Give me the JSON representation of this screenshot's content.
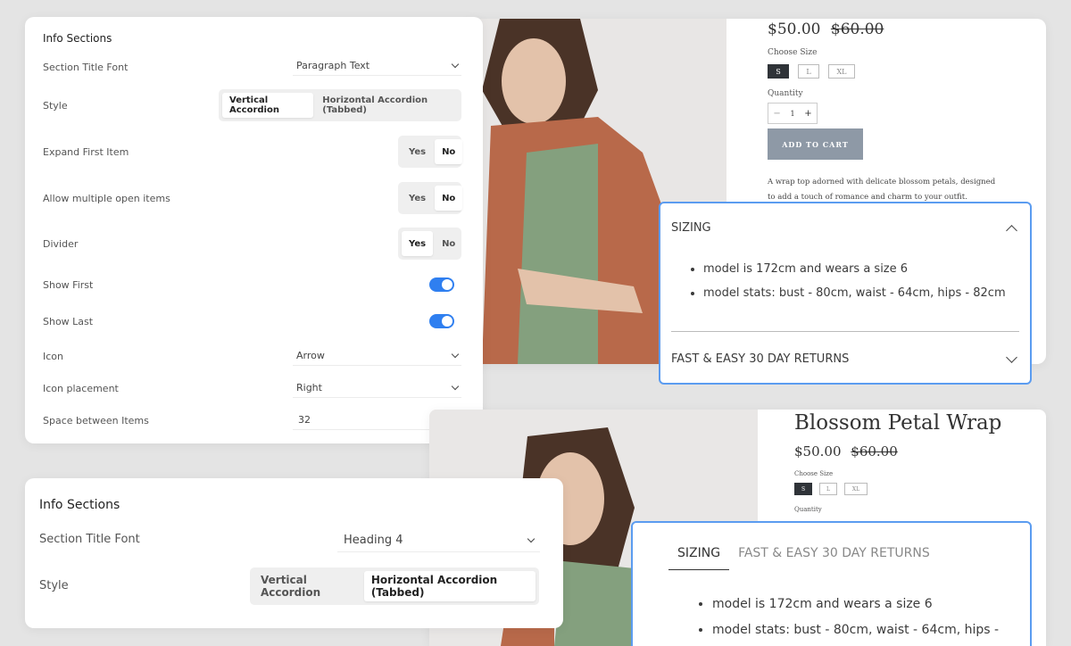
{
  "settings_full": {
    "heading": "Info Sections",
    "section_title_font": {
      "label": "Section Title Font",
      "value": "Paragraph Text"
    },
    "style": {
      "label": "Style",
      "options": [
        "Vertical Accordion",
        "Horizontal Accordion (Tabbed)"
      ],
      "selected": "Vertical Accordion"
    },
    "expand_first": {
      "label": "Expand First Item",
      "yes": "Yes",
      "no": "No",
      "selected": "No"
    },
    "allow_multiple": {
      "label": "Allow multiple open items",
      "yes": "Yes",
      "no": "No",
      "selected": "No"
    },
    "divider": {
      "label": "Divider",
      "yes": "Yes",
      "no": "No",
      "selected": "Yes"
    },
    "show_first": {
      "label": "Show First",
      "on": true
    },
    "show_last": {
      "label": "Show Last",
      "on": true
    },
    "icon": {
      "label": "Icon",
      "value": "Arrow"
    },
    "icon_placement": {
      "label": "Icon placement",
      "value": "Right"
    },
    "space_between": {
      "label": "Space between Items",
      "value": "32"
    }
  },
  "settings_small": {
    "heading": "Info Sections",
    "section_title_font": {
      "label": "Section Title Font",
      "value": "Heading 4"
    },
    "style": {
      "label": "Style",
      "options": [
        "Vertical Accordion",
        "Horizontal Accordion (Tabbed)"
      ],
      "selected": "Horizontal Accordion (Tabbed)"
    }
  },
  "product_top": {
    "price": "$50.00",
    "compare_price": "$60.00",
    "size_label": "Choose Size",
    "sizes": [
      "S",
      "L",
      "XL"
    ],
    "selected_size": "S",
    "quantity_label": "Quantity",
    "quantity": "1",
    "minus": "−",
    "plus": "+",
    "add_to_cart": "ADD TO CART",
    "description": "A wrap top adorned with delicate blossom petals, designed to add a touch of romance and charm to your outfit."
  },
  "accordion_vertical": {
    "items": [
      {
        "title": "SIZING",
        "open": true,
        "bullets": [
          "model is 172cm and wears a size 6",
          "model stats: bust - 80cm, waist - 64cm, hips - 82cm"
        ]
      },
      {
        "title": "FAST & EASY 30 DAY RETURNS",
        "open": false
      }
    ]
  },
  "product_bottom": {
    "title": "Blossom Petal Wrap",
    "price": "$50.00",
    "compare_price": "$60.00",
    "size_label": "Choose Size",
    "sizes": [
      "S",
      "L",
      "XL"
    ],
    "selected_size": "S",
    "quantity_label": "Quantity"
  },
  "accordion_tabbed": {
    "tabs": [
      "SIZING",
      "FAST & EASY 30 DAY RETURNS"
    ],
    "active_tab": "SIZING",
    "bullets": [
      "model is 172cm and wears a size 6",
      "model stats: bust - 80cm, waist - 64cm, hips -"
    ]
  },
  "colors": {
    "accent_blue": "#2f7ff0",
    "accordion_border": "#5b9cf0",
    "add_to_cart_bg": "#8e99a6",
    "jacket": "#b8694a",
    "top": "#84a07e"
  }
}
